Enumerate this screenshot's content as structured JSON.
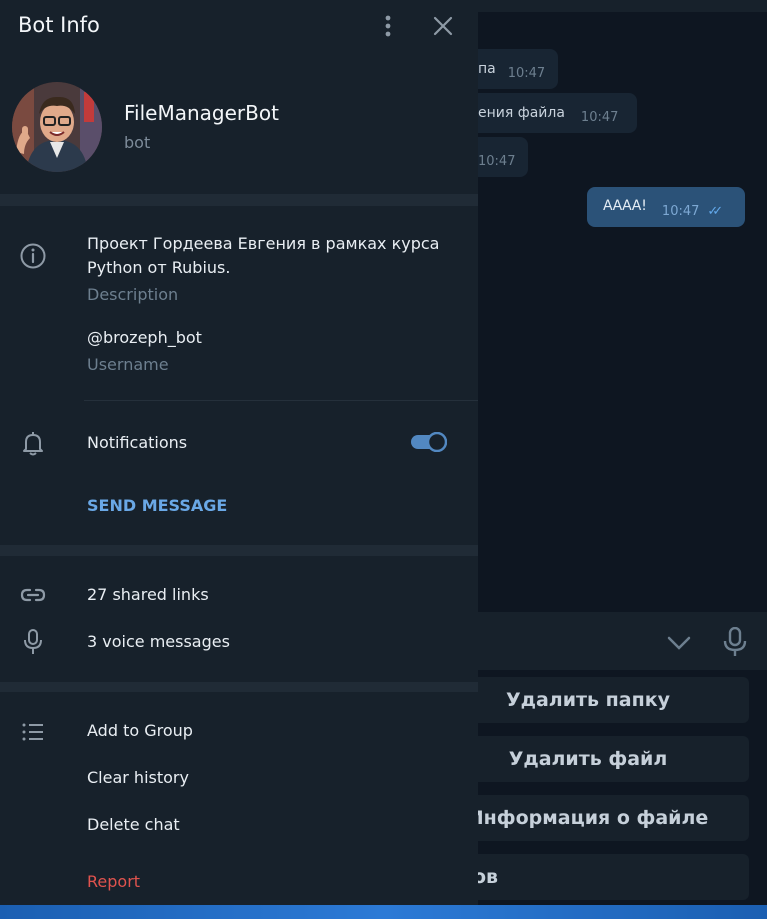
{
  "chat": {
    "messages": [
      {
        "text": "па",
        "time": "10:47"
      },
      {
        "text": "ения файла",
        "time": "10:47"
      },
      {
        "text": "",
        "time": "10:47"
      },
      {
        "text": "АААА!",
        "time": "10:47",
        "outgoing": true
      }
    ],
    "keyboard_buttons": [
      "Удалить папку",
      "Удалить файл",
      "Информация о файле",
      "ов"
    ]
  },
  "panel": {
    "title": "Bot Info",
    "bot_name": "FileManagerBot",
    "bot_subtitle": "bot",
    "description_line1": "Проект Гордеева Евгения в рамках курса",
    "description_line2": "Python от Rubius.",
    "description_label": "Description",
    "username": "@brozeph_bot",
    "username_label": "Username",
    "notifications_label": "Notifications",
    "notifications_on": true,
    "send_message": "SEND MESSAGE",
    "shared_links": "27 shared links",
    "voice_messages": "3 voice messages",
    "add_to_group": "Add to Group",
    "clear_history": "Clear history",
    "delete_chat": "Delete chat",
    "report": "Report"
  },
  "colors": {
    "panel_bg": "#17212b",
    "chat_bg": "#0e1621",
    "accent": "#6aa8e6",
    "toggle": "#5288c1",
    "danger": "#e0534e"
  }
}
